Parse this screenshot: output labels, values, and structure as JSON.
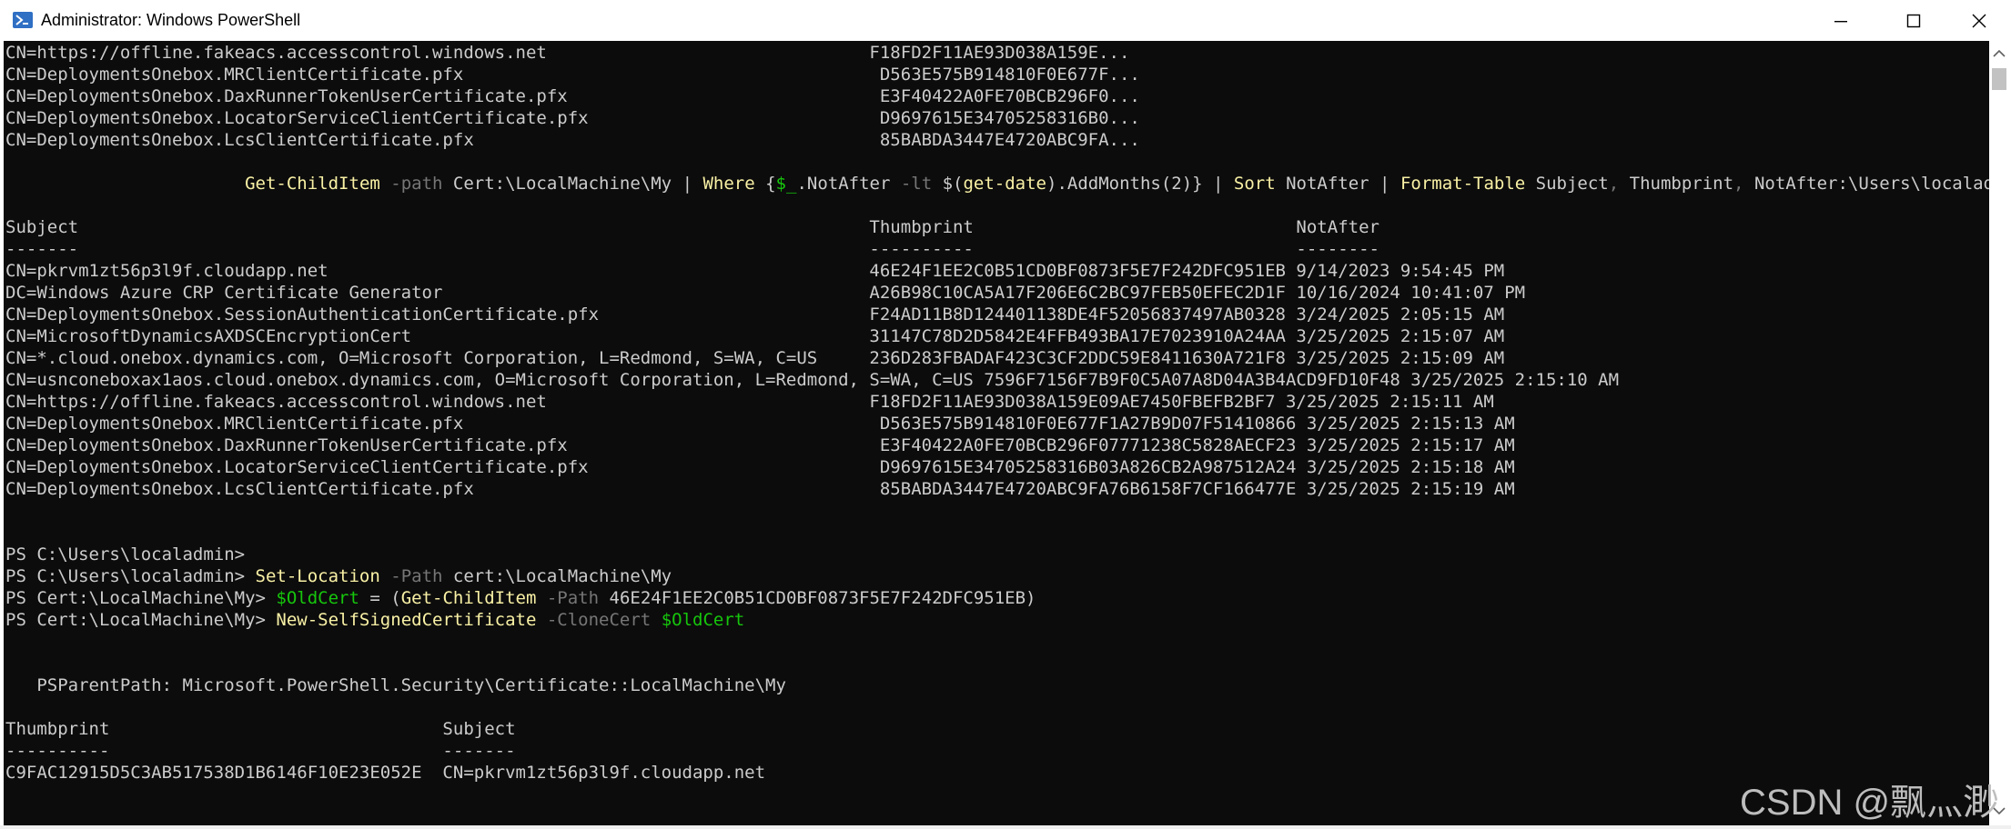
{
  "window": {
    "title": "Administrator: Windows PowerShell"
  },
  "console": {
    "lines": [
      [
        {
          "t": "CN=https://offline.fakeacs.accesscontrol.windows.net                               F18FD2F11AE93D038A159E..."
        }
      ],
      [
        {
          "t": "CN=DeploymentsOnebox.MRClientCertificate.pfx                                        D563E575B914810F0E677F..."
        }
      ],
      [
        {
          "t": "CN=DeploymentsOnebox.DaxRunnerTokenUserCertificate.pfx                              E3F40422A0FE70BCB296F0..."
        }
      ],
      [
        {
          "t": "CN=DeploymentsOnebox.LocatorServiceClientCertificate.pfx                            D9697615E34705258316B0..."
        }
      ],
      [
        {
          "t": "CN=DeploymentsOnebox.LcsClientCertificate.pfx                                       85BABDA3447E4720ABC9FA..."
        }
      ],
      [
        {
          "t": ""
        }
      ],
      [
        {
          "t": "                       "
        },
        {
          "t": "Get-ChildItem",
          "c": "y"
        },
        {
          "t": " -path",
          "c": "g"
        },
        {
          "t": " Cert:\\LocalMachine\\My | "
        },
        {
          "t": "Where",
          "c": "y"
        },
        {
          "t": " {"
        },
        {
          "t": "$_",
          "c": "gr"
        },
        {
          "t": ".NotAfter "
        },
        {
          "t": "-lt",
          "c": "g"
        },
        {
          "t": " $("
        },
        {
          "t": "get-date",
          "c": "y"
        },
        {
          "t": ").AddMonths(2)} | "
        },
        {
          "t": "Sort",
          "c": "y"
        },
        {
          "t": " NotAfter | "
        },
        {
          "t": "Format-Table",
          "c": "y"
        },
        {
          "t": " Subject"
        },
        {
          "t": ",",
          "c": "g"
        },
        {
          "t": " Thumbprint"
        },
        {
          "t": ",",
          "c": "g"
        },
        {
          "t": " NotAfter:\\Users\\localadmin>"
        }
      ],
      [
        {
          "t": ""
        }
      ],
      [
        {
          "t": "Subject                                                                            Thumbprint                               NotAfter"
        }
      ],
      [
        {
          "t": "-------                                                                            ----------                               --------"
        }
      ],
      [
        {
          "t": "CN=pkrvm1zt56p3l9f.cloudapp.net                                                    46E24F1EE2C0B51CD0BF0873F5E7F242DFC951EB 9/14/2023 9:54:45 PM"
        }
      ],
      [
        {
          "t": "DC=Windows Azure CRP Certificate Generator                                         A26B98C10CA5A17F206E6C2BC97FEB50EFEC2D1F 10/16/2024 10:41:07 PM"
        }
      ],
      [
        {
          "t": "CN=DeploymentsOnebox.SessionAuthenticationCertificate.pfx                          F24AD11B8D124401138DE4F52056837497AB0328 3/24/2025 2:05:15 AM"
        }
      ],
      [
        {
          "t": "CN=MicrosoftDynamicsAXDSCEncryptionCert                                            31147C78D2D5842E4FFB493BA17E7023910A24AA 3/25/2025 2:15:07 AM"
        }
      ],
      [
        {
          "t": "CN=*.cloud.onebox.dynamics.com, O=Microsoft Corporation, L=Redmond, S=WA, C=US     236D283FBADAF423C3CF2DDC59E8411630A721F8 3/25/2025 2:15:09 AM"
        }
      ],
      [
        {
          "t": "CN=usnconeboxax1aos.cloud.onebox.dynamics.com, O=Microsoft Corporation, L=Redmond, S=WA, C=US 7596F7156F7B9F0C5A07A8D04A3B4ACD9FD10F48 3/25/2025 2:15:10 AM"
        }
      ],
      [
        {
          "t": "CN=https://offline.fakeacs.accesscontrol.windows.net                               F18FD2F11AE93D038A159E09AE7450FBEFB2BF7 3/25/2025 2:15:11 AM"
        }
      ],
      [
        {
          "t": "CN=DeploymentsOnebox.MRClientCertificate.pfx                                        D563E575B914810F0E677F1A27B9D07F51410866 3/25/2025 2:15:13 AM"
        }
      ],
      [
        {
          "t": "CN=DeploymentsOnebox.DaxRunnerTokenUserCertificate.pfx                              E3F40422A0FE70BCB296F07771238C5828AECF23 3/25/2025 2:15:17 AM"
        }
      ],
      [
        {
          "t": "CN=DeploymentsOnebox.LocatorServiceClientCertificate.pfx                            D9697615E34705258316B03A826CB2A987512A24 3/25/2025 2:15:18 AM"
        }
      ],
      [
        {
          "t": "CN=DeploymentsOnebox.LcsClientCertificate.pfx                                       85BABDA3447E4720ABC9FA76B6158F7CF166477E 3/25/2025 2:15:19 AM"
        }
      ],
      [
        {
          "t": ""
        }
      ],
      [
        {
          "t": ""
        }
      ],
      [
        {
          "t": "PS C:\\Users\\localadmin>"
        }
      ],
      [
        {
          "t": "PS C:\\Users\\localadmin> "
        },
        {
          "t": "Set-Location",
          "c": "y"
        },
        {
          "t": " -Path",
          "c": "g"
        },
        {
          "t": " cert:\\LocalMachine\\My"
        }
      ],
      [
        {
          "t": "PS Cert:\\LocalMachine\\My> "
        },
        {
          "t": "$OldCert",
          "c": "gr"
        },
        {
          "t": " = ("
        },
        {
          "t": "Get-ChildItem",
          "c": "y"
        },
        {
          "t": " -Path",
          "c": "g"
        },
        {
          "t": " 46E24F1EE2C0B51CD0BF0873F5E7F242DFC951EB)"
        }
      ],
      [
        {
          "t": "PS Cert:\\LocalMachine\\My> "
        },
        {
          "t": "New-SelfSignedCertificate",
          "c": "y"
        },
        {
          "t": " -CloneCert",
          "c": "g"
        },
        {
          "t": " "
        },
        {
          "t": "$OldCert",
          "c": "gr"
        }
      ],
      [
        {
          "t": ""
        }
      ],
      [
        {
          "t": ""
        }
      ],
      [
        {
          "t": "   PSParentPath: Microsoft.PowerShell.Security\\Certificate::LocalMachine\\My"
        }
      ],
      [
        {
          "t": ""
        }
      ],
      [
        {
          "t": "Thumbprint                                Subject"
        }
      ],
      [
        {
          "t": "----------                                -------"
        }
      ],
      [
        {
          "t": "C9FAC12915D5C3AB517538D1B6146F10E23E052E  CN=pkrvm1zt56p3l9f.cloudapp.net"
        }
      ]
    ]
  },
  "watermark": "CSDN @飘灬渺",
  "icons": {
    "app": "powershell-icon",
    "minimize": "minimize-icon",
    "maximize": "maximize-icon",
    "close": "close-icon",
    "scroll_up": "scroll-up-arrow-icon",
    "scroll_down": "scroll-down-arrow-icon"
  },
  "colors": {
    "console_bg": "#0c0c0c",
    "console_text": "#cccccc",
    "cmdlet": "#f9f1a5",
    "parameter": "#767676",
    "variable": "#16c60c",
    "icon_blue": "#2f6fc4"
  }
}
